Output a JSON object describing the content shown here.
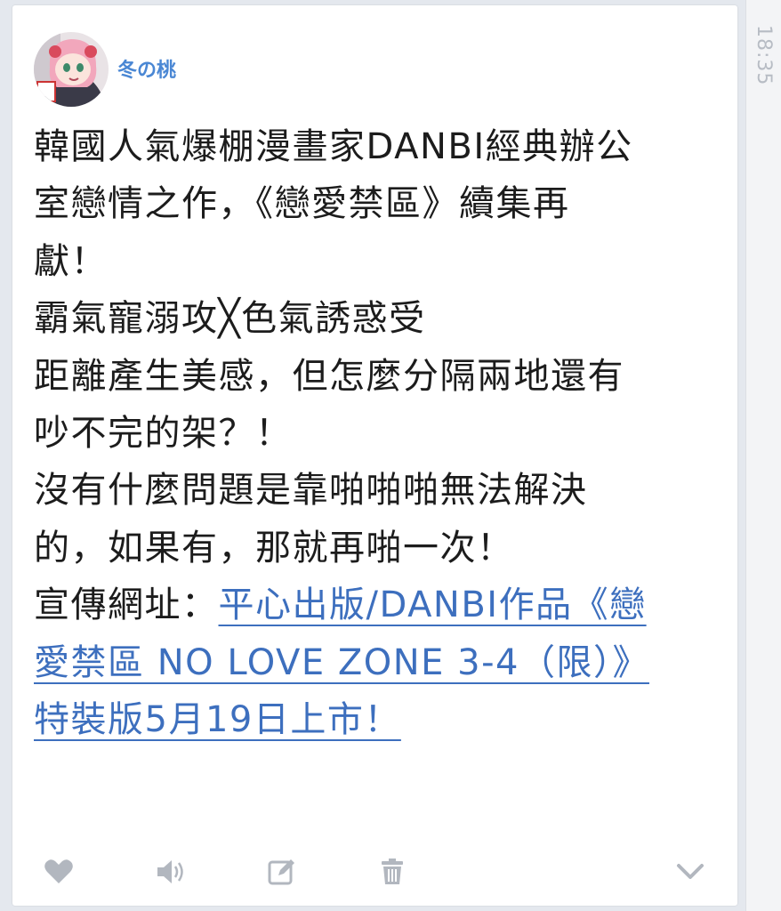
{
  "status": {
    "time": "18:35"
  },
  "post": {
    "username": "冬の桃",
    "lines": [
      "韓國人氣爆棚漫畫家DANBI經典辦公",
      "室戀情之作，《戀愛禁區》續集再",
      "獻！",
      "霸氣寵溺攻╳色氣誘惑受",
      "距離產生美感，但怎麼分隔兩地還有",
      "吵不完的架？！",
      "沒有什麼問題是靠啪啪啪無法解決",
      "的，如果有，那就再啪一次！"
    ],
    "promo_label": "宣傳網址：",
    "promo_link_lines": [
      "平心出版/DANBI作品《戀",
      "愛禁區 NO LOVE ZONE 3-4（限）》",
      "特裝版5月19日上市！"
    ]
  },
  "actions": {
    "icons": [
      "heart-icon",
      "speaker-icon",
      "edit-icon",
      "trash-icon",
      "chevron-down-icon"
    ]
  },
  "colors": {
    "link": "#3d6fbe",
    "username": "#4a87d4",
    "icon": "#b2b7bf"
  }
}
